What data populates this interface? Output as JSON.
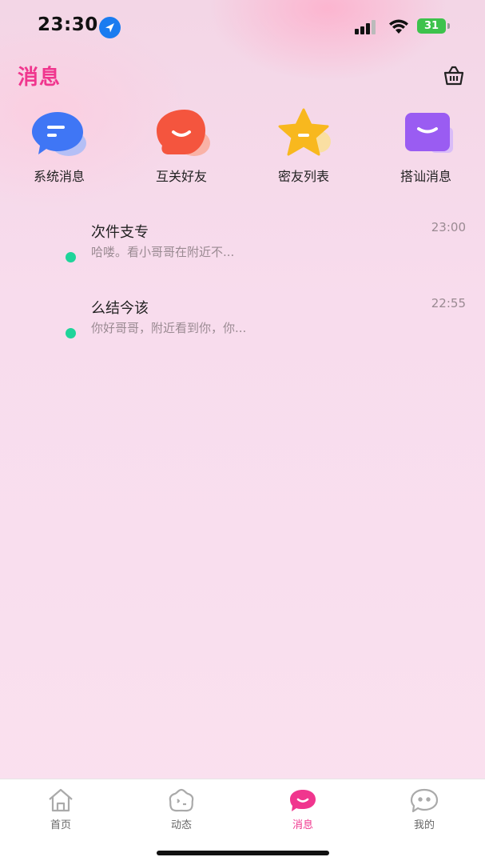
{
  "status_bar": {
    "time": "23:30",
    "battery": "31",
    "icons": [
      "location-arrow-icon",
      "cellular-signal-icon",
      "wifi-icon",
      "battery-charging-icon"
    ]
  },
  "header": {
    "title": "消息",
    "action_icon": "shop-basket-icon"
  },
  "quick_actions": [
    {
      "label": "系统消息",
      "icon": "system-message-icon",
      "color": "#3f76f5"
    },
    {
      "label": "互关好友",
      "icon": "mutual-friends-icon",
      "color": "#f4553e"
    },
    {
      "label": "密友列表",
      "icon": "close-friends-star-icon",
      "color": "#f8b81e"
    },
    {
      "label": "搭讪消息",
      "icon": "greeting-message-icon",
      "color": "#9a5cf2"
    }
  ],
  "messages": [
    {
      "name": "次件支专",
      "preview": "哈喽。看小哥哥在附近不...",
      "time": "23:00",
      "online": true
    },
    {
      "name": "么结今该",
      "preview": "你好哥哥，附近看到你，你...",
      "time": "22:55",
      "online": true
    }
  ],
  "tab_bar": {
    "items": [
      {
        "label": "首页",
        "icon": "home-icon",
        "active": false
      },
      {
        "label": "动态",
        "icon": "moments-icon",
        "active": false
      },
      {
        "label": "消息",
        "icon": "message-bubble-icon",
        "active": true
      },
      {
        "label": "我的",
        "icon": "profile-face-icon",
        "active": false
      }
    ]
  },
  "colors": {
    "accent": "#f0368e",
    "online": "#1fd49a",
    "battery": "#3dc24c"
  }
}
